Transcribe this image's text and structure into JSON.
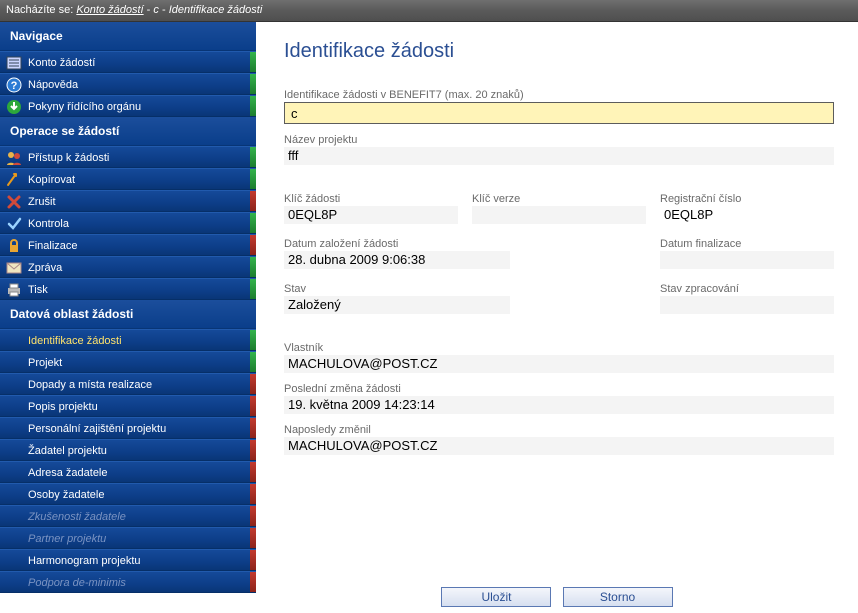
{
  "breadcrumb": {
    "prefix": "Nacházíte se:",
    "link": "Konto žádostí",
    "mid": "c",
    "tail": "Identifikace žádosti"
  },
  "sidebar": {
    "headers": {
      "nav": "Navigace",
      "ops": "Operace se žádostí",
      "data": "Datová oblast žádosti"
    },
    "nav": [
      {
        "label": "Konto žádostí"
      },
      {
        "label": "Nápověda"
      },
      {
        "label": "Pokyny řídícího orgánu"
      }
    ],
    "ops": [
      {
        "label": "Přístup k žádosti"
      },
      {
        "label": "Kopírovat"
      },
      {
        "label": "Zrušit"
      },
      {
        "label": "Kontrola"
      },
      {
        "label": "Finalizace"
      },
      {
        "label": "Zpráva"
      },
      {
        "label": "Tisk"
      }
    ],
    "data": [
      {
        "label": "Identifikace žádosti"
      },
      {
        "label": "Projekt"
      },
      {
        "label": "Dopady a místa realizace"
      },
      {
        "label": "Popis projektu"
      },
      {
        "label": "Personální zajištění projektu"
      },
      {
        "label": "Žadatel projektu"
      },
      {
        "label": "Adresa žadatele"
      },
      {
        "label": "Osoby žadatele"
      },
      {
        "label": "Zkušenosti žadatele"
      },
      {
        "label": "Partner projektu"
      },
      {
        "label": "Harmonogram projektu"
      },
      {
        "label": "Podpora de-minimis"
      }
    ]
  },
  "page": {
    "title": "Identifikace žádosti",
    "id_label": "Identifikace žádosti v BENEFIT7 (max. 20 znaků)",
    "id_value": "c",
    "project_name_label": "Název projektu",
    "project_name_value": "fff",
    "key_req_label": "Klíč žádosti",
    "key_req_value": "0EQL8P",
    "key_ver_label": "Klíč verze",
    "key_ver_value": "",
    "reg_no_label": "Registrační číslo",
    "reg_no_value": "0EQL8P",
    "created_label": "Datum založení žádosti",
    "created_value": "28. dubna 2009 9:06:38",
    "finalized_label": "Datum finalizace",
    "finalized_value": "",
    "state_label": "Stav",
    "state_value": "Založený",
    "proc_state_label": "Stav zpracování",
    "proc_state_value": "",
    "owner_label": "Vlastník",
    "owner_value": "MACHULOVA@POST.CZ",
    "last_change_label": "Poslední změna žádosti",
    "last_change_value": "19. května 2009 14:23:14",
    "last_changed_by_label": "Naposledy změnil",
    "last_changed_by_value": "MACHULOVA@POST.CZ"
  },
  "buttons": {
    "save": "Uložit",
    "cancel": "Storno"
  }
}
